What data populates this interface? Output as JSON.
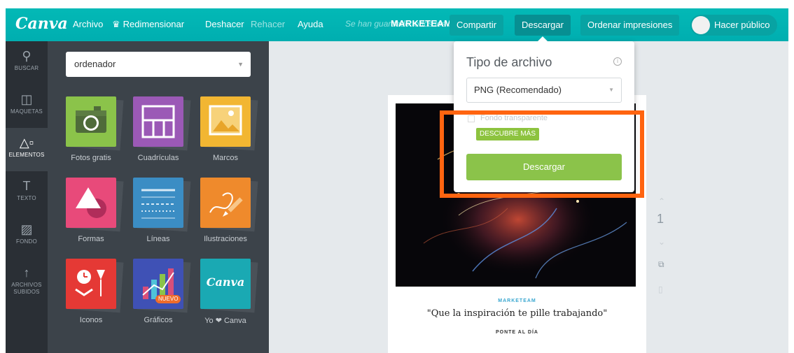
{
  "app": {
    "logo": "Canva",
    "colors": {
      "topbar": "#00b5b3",
      "highlight": "#ff6410",
      "accent_green": "#8bc34a"
    }
  },
  "topbar": {
    "menu": [
      "Archivo",
      "Redimensionar",
      "Deshacer",
      "Rehacer",
      "Ayuda"
    ],
    "crown_icon": "crown-icon",
    "saved_status": "Se han guardado todos los cambios",
    "doc_title": "MARKETEAM",
    "share": "Compartir",
    "download": "Descargar",
    "print": "Ordenar impresiones",
    "public": "Hacer público"
  },
  "leftnav": {
    "items": [
      {
        "label": "BUSCAR",
        "icon": "search-icon"
      },
      {
        "label": "MAQUETAS",
        "icon": "layout-icon"
      },
      {
        "label": "ELEMENTOS",
        "icon": "shapes-icon"
      },
      {
        "label": "TEXTO",
        "icon": "text-icon"
      },
      {
        "label": "FONDO",
        "icon": "background-icon"
      },
      {
        "label": "ARCHIVOS SUBIDOS",
        "icon": "upload-icon"
      }
    ]
  },
  "panel": {
    "search_value": "ordenador",
    "tiles": [
      {
        "label": "Fotos gratis",
        "icon": "camera-icon",
        "color": "#8bc34a"
      },
      {
        "label": "Cuadrículas",
        "icon": "grid-icon",
        "color": "#9b59b6"
      },
      {
        "label": "Marcos",
        "icon": "frame-icon",
        "color": "#f2b632"
      },
      {
        "label": "Formas",
        "icon": "shapes-icon",
        "color": "#e84a7a"
      },
      {
        "label": "Líneas",
        "icon": "lines-icon",
        "color": "#3b8dc4"
      },
      {
        "label": "Ilustraciones",
        "icon": "pencil-icon",
        "color": "#ef8a2c"
      },
      {
        "label": "Iconos",
        "icon": "icons-icon",
        "color": "#e53935"
      },
      {
        "label": "Gráficos",
        "icon": "chart-icon",
        "color": "#3f51b5",
        "badge": "NUEVO"
      },
      {
        "label": "Yo ❤ Canva",
        "icon": "canva-logo-icon",
        "color": "#1aa9b3",
        "tile_text": "Canva"
      }
    ]
  },
  "canvas": {
    "brand": "MARKETEAM",
    "quote": "\"Que la inspiración te pille trabajando\"",
    "subtitle": "PONTE AL DÍA",
    "page_number": "1"
  },
  "download_menu": {
    "title": "Tipo de archivo",
    "file_type": "PNG (Recomendado)",
    "transparent_label": "Fondo transparente",
    "discover": "DESCUBRE MÁS",
    "button": "Descargar"
  }
}
